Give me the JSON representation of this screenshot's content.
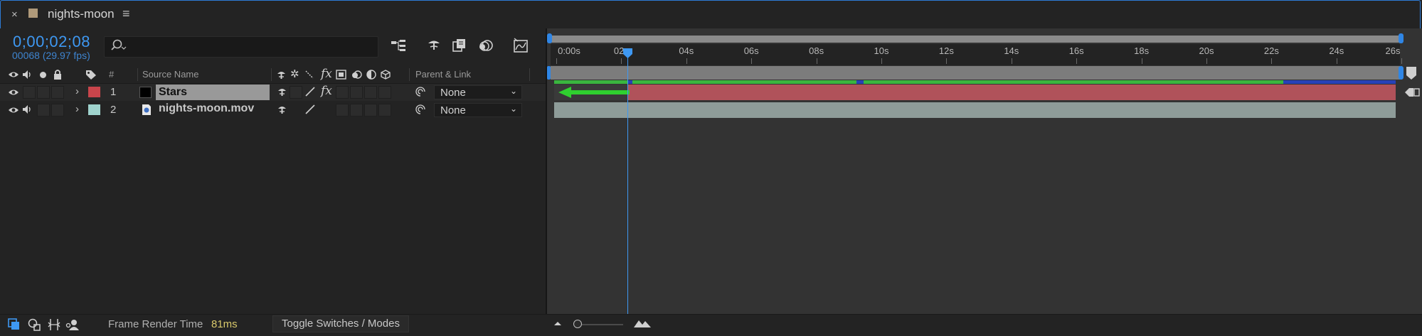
{
  "tab": {
    "title": "nights-moon",
    "close_glyph": "×",
    "menu_glyph": "≡"
  },
  "timecode": {
    "value": "0;00;02;08",
    "frames_fps": "00068 (29.97 fps)"
  },
  "search": {
    "placeholder": ""
  },
  "columns": {
    "hash": "#",
    "source_name": "Source Name",
    "parent_link": "Parent & Link"
  },
  "layers": [
    {
      "number": "1",
      "name": "Stars",
      "label_color": "#c9454b",
      "parent": "None"
    },
    {
      "number": "2",
      "name": "nights-moon.mov",
      "label_color": "#9fd3cd",
      "parent": "None"
    }
  ],
  "ruler": {
    "ticks": [
      "0:00s",
      "02s",
      "04s",
      "06s",
      "08s",
      "10s",
      "12s",
      "14s",
      "16s",
      "18s",
      "20s",
      "22s",
      "24s",
      "26s"
    ]
  },
  "bottom": {
    "frame_render_label": "Frame Render Time",
    "frame_render_value": "81ms",
    "toggle_label": "Toggle Switches / Modes"
  },
  "colors": {
    "accent": "#3e98f2",
    "layer1_bar": "#b0525a",
    "layer2_bar": "#8e9c99",
    "cache_green": "#3ab53f",
    "cache_blue": "#2741b7",
    "arrow": "#2fd12f"
  },
  "icons": [
    "close-icon",
    "composition-icon",
    "menu-icon",
    "search-icon",
    "eye-icon",
    "audio-icon",
    "solo-icon",
    "lock-icon",
    "label-icon",
    "shy-icon",
    "fx-icon",
    "parent-pickwhip-icon",
    "chevron-down-icon",
    "comp-marker-icon"
  ]
}
